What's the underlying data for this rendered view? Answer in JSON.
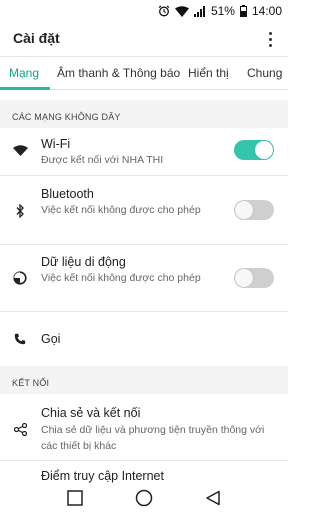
{
  "status_bar": {
    "battery": "51%",
    "time": "14:00"
  },
  "app_bar": {
    "title": "Cài đặt",
    "menu_icon": "more-vert-icon"
  },
  "tabs": [
    {
      "label": "Mạng",
      "active": true
    },
    {
      "label": "Âm thanh & Thông báo",
      "active": false
    },
    {
      "label": "Hiển thị",
      "active": false
    },
    {
      "label": "Chung",
      "active": false
    }
  ],
  "sections": {
    "wireless": "CÁC MẠNG KHÔNG DÂY",
    "connect": "KẾT NỐI"
  },
  "settings": {
    "wifi": {
      "label": "Wi-Fi",
      "sub": "Được kết nối với NHA THI",
      "on": true,
      "icon": "wifi-icon"
    },
    "bluetooth": {
      "label": "Bluetooth",
      "sub": "Việc kết nối không được cho phép",
      "on": false,
      "icon": "bluetooth-icon"
    },
    "mobile_data": {
      "label": "Dữ liệu di động",
      "sub": "Việc kết nối không được cho phép",
      "on": false,
      "icon": "data-usage-icon"
    },
    "call": {
      "label": "Gọi",
      "icon": "phone-icon"
    },
    "share": {
      "label": "Chia sẻ và kết nối",
      "sub": "Chia sẻ dữ liệu và phương tiện truyền thông với các thiết bị khác",
      "icon": "share-icon"
    },
    "hotspot": {
      "label": "Điểm truy cập Internet"
    }
  },
  "colors": {
    "accent": "#17a08d",
    "toggle_on": "#35c4ae",
    "toggle_off": "#cfcfcf",
    "section_bg": "#f4f4f4"
  },
  "nav_bar": {
    "icons": [
      "recents-square-icon",
      "home-circle-icon",
      "back-triangle-icon"
    ]
  }
}
